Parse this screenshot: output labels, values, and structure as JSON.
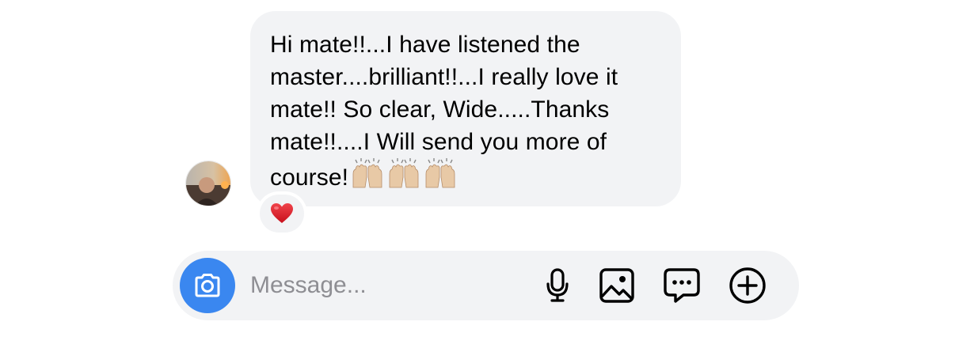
{
  "message": {
    "text": "Hi mate!!...I have listened the master....brilliant!!...I really love it mate!! So clear, Wide.....Thanks mate!!....I Will send you more of course!",
    "trailing_emoji": [
      "raising-hands-emoji",
      "raising-hands-emoji",
      "raising-hands-emoji"
    ],
    "reaction": "red-heart-emoji"
  },
  "composer": {
    "placeholder": "Message...",
    "camera_icon": "camera-icon",
    "tools": [
      "microphone-icon",
      "image-icon",
      "sticker-chat-icon",
      "plus-circle-icon"
    ]
  },
  "colors": {
    "bubble": "#f2f3f5",
    "camera_button": "#3a87f0",
    "heart": "#e0202e",
    "skin": "#e8c9a6"
  }
}
